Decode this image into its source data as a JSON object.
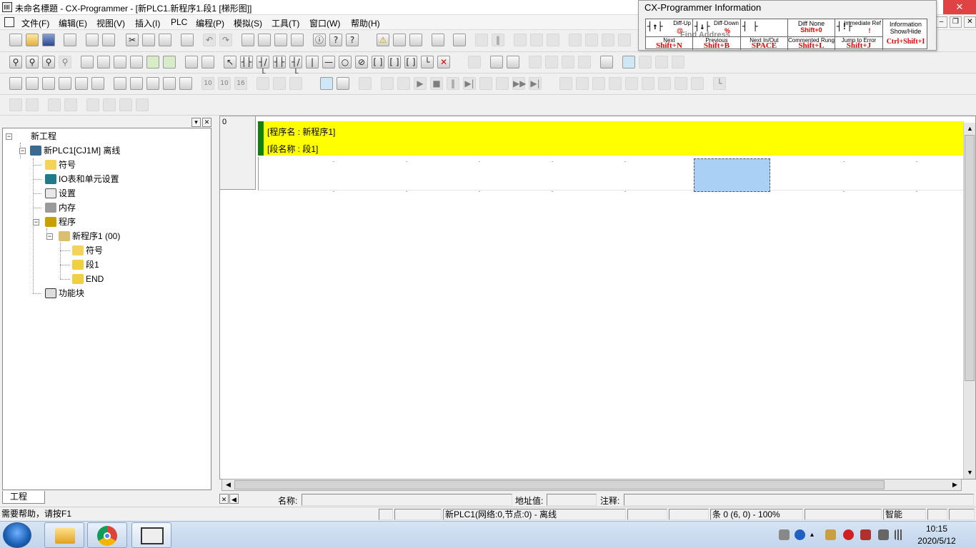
{
  "window": {
    "title": "未命名標題 - CX-Programmer - [新PLC1.新程序1.段1 [梯形图]]",
    "close_symbol": "✕"
  },
  "menu": [
    "文件(F)",
    "编辑(E)",
    "视图(V)",
    "插入(I)",
    "PLC",
    "编程(P)",
    "模拟(S)",
    "工具(T)",
    "窗口(W)",
    "帮助(H)"
  ],
  "mdi_controls": [
    "–",
    "❐",
    "✕"
  ],
  "info_window": {
    "title": "CX-Programmer Information",
    "cells": [
      {
        "symbol": "┤↑├",
        "small": "Diff-Up",
        "mid": "@",
        "label": "Next",
        "key": "Shift+N"
      },
      {
        "symbol": "┤↓├",
        "small": "Diff-Down",
        "mid": "%",
        "label": "Previous",
        "key": "Shift+B"
      },
      {
        "symbol": "┤ ├",
        "small": "",
        "mid": "",
        "label": "Next In/Out",
        "key": "SPACE"
      },
      {
        "symbol": "",
        "small": "Diff None",
        "mid": "Shift+0",
        "label": "Commented Rung",
        "key": "Shift+L"
      },
      {
        "symbol": "┤!├",
        "small": "Immediate Ref",
        "mid": "!",
        "label": "Jump to Error",
        "key": "Shift+J"
      },
      {
        "symbol": "",
        "small": "",
        "mid": "",
        "label": "Information Show/Hide",
        "key": "Ctrl+Shift+I"
      }
    ],
    "overlay_text": "Find Address"
  },
  "project_panel": {
    "tab_label": "工程",
    "tree": [
      {
        "label": "新工程",
        "level": 0,
        "icon": "project-icon",
        "expanded": true
      },
      {
        "label": "新PLC1[CJ1M] 离线",
        "level": 1,
        "icon": "plc-icon",
        "expanded": true
      },
      {
        "label": "符号",
        "level": 2,
        "icon": "symbols-icon"
      },
      {
        "label": "IO表和单元设置",
        "level": 2,
        "icon": "io-table-icon"
      },
      {
        "label": "设置",
        "level": 2,
        "icon": "settings-icon"
      },
      {
        "label": "内存",
        "level": 2,
        "icon": "memory-icon"
      },
      {
        "label": "程序",
        "level": 2,
        "icon": "programs-icon",
        "expanded": true
      },
      {
        "label": "新程序1 (00)",
        "level": 3,
        "icon": "program-icon",
        "expanded": true
      },
      {
        "label": "符号",
        "level": 4,
        "icon": "symbols-icon"
      },
      {
        "label": "段1",
        "level": 4,
        "icon": "section-icon"
      },
      {
        "label": "END",
        "level": 4,
        "icon": "section-icon"
      },
      {
        "label": "功能块",
        "level": 2,
        "icon": "function-block-icon"
      }
    ]
  },
  "ladder": {
    "rung_number": "0",
    "program_line": "[程序名 : 新程序1]",
    "section_line": "[段名称 : 段1]"
  },
  "info_line": {
    "name_label": "名称:",
    "address_label": "地址值:",
    "comment_label": "注释:"
  },
  "status_bar": {
    "help": "需要帮助，请按F1",
    "plc_status": "新PLC1(网络:0,节点:0) - 离线",
    "rung_status": "条 0 (6, 0)  - 100%",
    "mode": "智能"
  },
  "taskbar": {
    "time": "10:15",
    "date": "2020/5/12"
  },
  "colors": {
    "rung_header": "#ffff00",
    "rung_bar": "#108010",
    "cursor": "#aad0f5",
    "close_button": "#e04343"
  }
}
